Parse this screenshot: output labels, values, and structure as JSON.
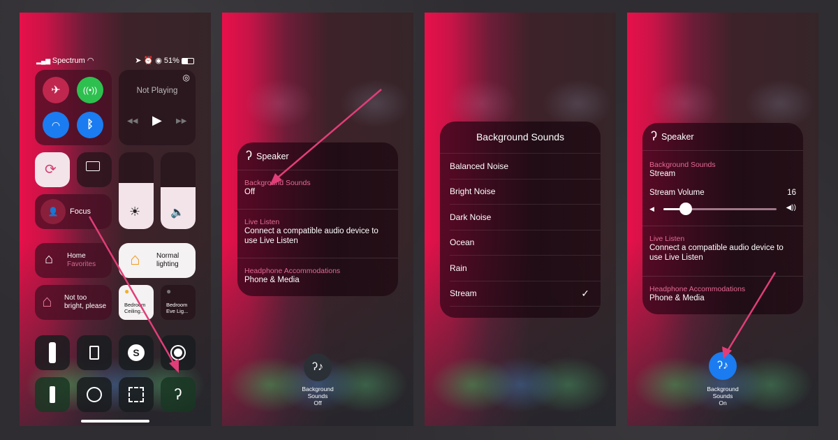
{
  "accent": "#e23d78",
  "panel1": {
    "status": {
      "carrier": "Spectrum",
      "battery": "51%"
    },
    "connectivity": {
      "airplane": "airplane-mode",
      "cellular": "cellular-data",
      "wifi": "wi-fi",
      "bluetooth": "bluetooth"
    },
    "media": {
      "title": "Not Playing"
    },
    "focus": {
      "label": "Focus"
    },
    "home": {
      "title": "Home",
      "subtitle": "Favorites"
    },
    "scene1": {
      "label1": "Normal",
      "label2": "lighting"
    },
    "scene2": {
      "label1": "Not too",
      "label2": "bright, please"
    },
    "accessory1": {
      "label1": "Bedroom",
      "label2": "Ceiling..."
    },
    "accessory2": {
      "label1": "Bedroom",
      "label2": "Eve Lig..."
    },
    "brightness_level": 0.6,
    "volume_level": 0.55
  },
  "panel2": {
    "header": "Speaker",
    "rows": [
      {
        "label": "Background Sounds",
        "value": "Off"
      },
      {
        "label": "Live Listen",
        "value": "Connect a compatible audio device to use Live Listen"
      },
      {
        "label": "Headphone Accommodations",
        "value": "Phone & Media"
      }
    ],
    "button": {
      "line1": "Background",
      "line2": "Sounds",
      "state": "Off"
    }
  },
  "panel3": {
    "title": "Background Sounds",
    "options": [
      "Balanced Noise",
      "Bright Noise",
      "Dark Noise",
      "Ocean",
      "Rain",
      "Stream"
    ],
    "selected": "Stream",
    "check": "✓"
  },
  "panel4": {
    "header": "Speaker",
    "bg": {
      "label": "Background Sounds",
      "value": "Stream"
    },
    "volume": {
      "label": "Stream Volume",
      "value": "16",
      "level": 0.2
    },
    "live": {
      "label": "Live Listen",
      "value": "Connect a compatible audio device to use Live Listen"
    },
    "headphone": {
      "label": "Headphone Accommodations",
      "value": "Phone & Media"
    },
    "button": {
      "line1": "Background",
      "line2": "Sounds",
      "state": "On",
      "color": "#1a7cf0"
    }
  }
}
